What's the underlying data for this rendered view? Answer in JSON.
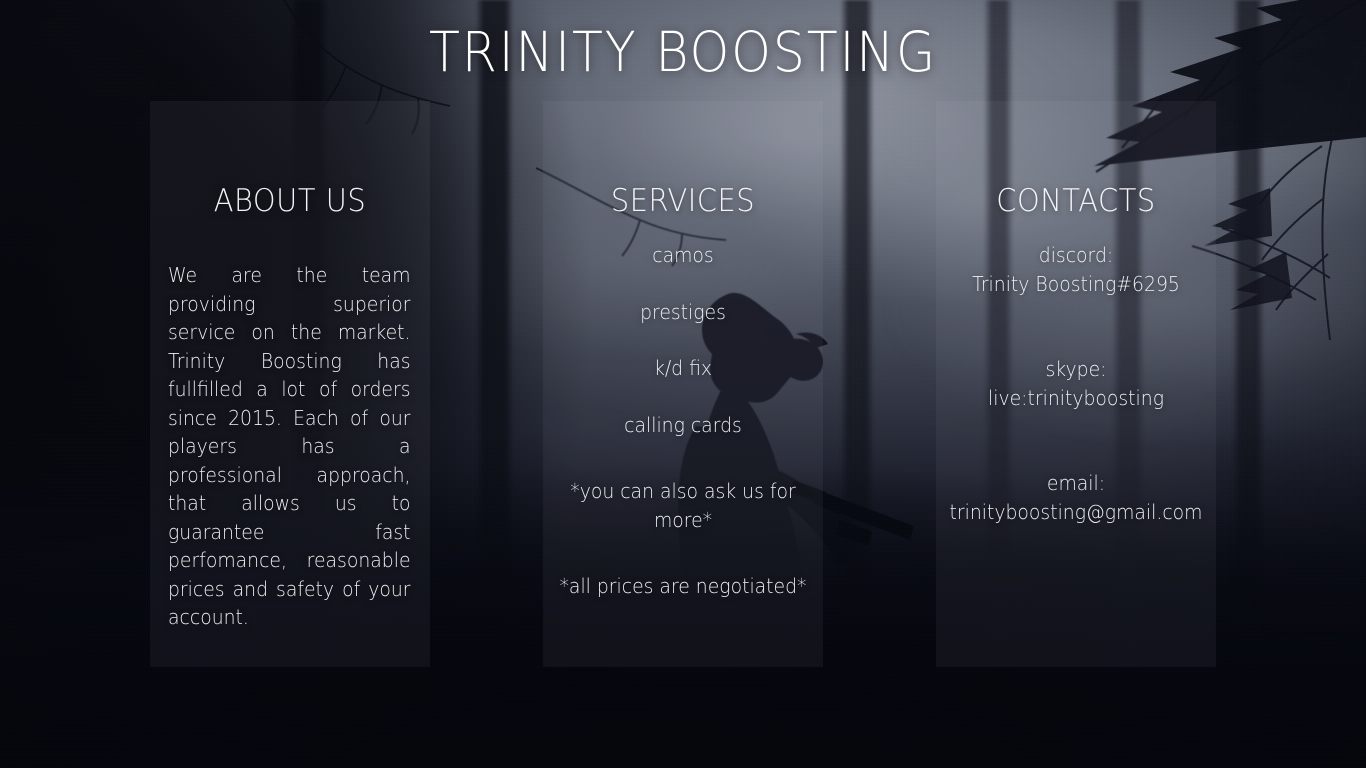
{
  "page": {
    "title": "TRINITY BOOSTING",
    "colors": {
      "text": "#eceef3",
      "title": "#ffffff",
      "panel_overlay": "rgba(214,220,235,0.055)",
      "background_dark": "#080a14",
      "background_fog": "#8d929e"
    },
    "background": {
      "scene_name": "dark-misty-forest-with-soldier-silhouette"
    }
  },
  "panels": {
    "about": {
      "title": "ABOUT US",
      "body": "We are the team providing superior service on the market. Trinity Boosting has fullfilled a lot of orders since 2015. Each of our players has a professional approach, that allows us to guarantee fast perfomance, reasonable prices and safety of your account."
    },
    "services": {
      "title": "SERVICES",
      "items": [
        "camos",
        "prestiges",
        "k/d fix",
        "calling cards"
      ],
      "notes": [
        "*you can also ask us for more*",
        "*all prices are negotiated*"
      ]
    },
    "contacts": {
      "title": "CONTACTS",
      "entries": [
        {
          "label": "discord:",
          "value": "Trinity Boosting#6295"
        },
        {
          "label": "skype:",
          "value": "live:trinityboosting"
        },
        {
          "label": "email:",
          "value": "trinityboosting@gmail.com"
        }
      ]
    }
  }
}
